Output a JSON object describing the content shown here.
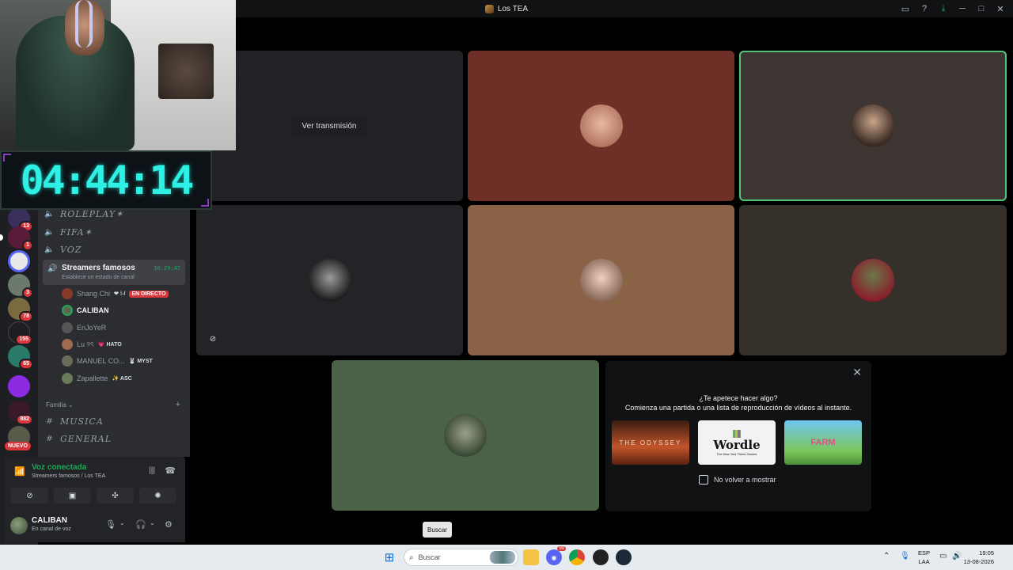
{
  "window": {
    "title": "Los TEA",
    "controls": [
      "inbox-icon",
      "help-icon",
      "download-icon",
      "minimize-icon",
      "maximize-icon",
      "close-icon"
    ]
  },
  "overlay": {
    "timer": "04:44:14"
  },
  "rail": {
    "badges": [
      "13",
      "1",
      "3",
      "78",
      "155",
      "65",
      "882"
    ],
    "new_label": "NUEVO"
  },
  "sidebar": {
    "channels_top": [
      {
        "name": "ROLEPLAY✶",
        "icon": "speaker-icon"
      },
      {
        "name": "FIFA✶",
        "icon": "speaker-icon"
      },
      {
        "name": "VOZ",
        "icon": "speaker-icon"
      }
    ],
    "voice_channel": {
      "name": "Streamers famosos",
      "status": "Establece un estado de canal",
      "timer": "30:29:47"
    },
    "members": [
      {
        "name": "Shang Chi",
        "extra": "❤ ⁞-/",
        "live": "EN DIRECTO"
      },
      {
        "name": "CALIBAN",
        "active": true
      },
      {
        "name": "EnJoYeR"
      },
      {
        "name": "Lu ୨ৎ",
        "tag": "💗 HATO"
      },
      {
        "name": "MANUEL CO...",
        "tag": "🐰 MYST"
      },
      {
        "name": "Zapallette",
        "tag": "✨ ASC"
      }
    ],
    "category": "Familia",
    "channels_bottom": [
      {
        "name": "MUSICA",
        "icon": "hash-icon"
      },
      {
        "name": "GENERAL",
        "icon": "hash-icon"
      }
    ]
  },
  "voice_panel": {
    "status": "Voz conectada",
    "location": "Streamers famosos / Los TEA"
  },
  "user_panel": {
    "name": "CALIBAN",
    "status": "En canal de voz"
  },
  "stage": {
    "watch_button": "Ver transmisión",
    "tiles": [
      {
        "color": "#202225"
      },
      {
        "color": "#6e2f26"
      },
      {
        "color": "#3d3531",
        "speaking": true
      },
      {
        "color": "#232427"
      },
      {
        "color": "#8a6346"
      },
      {
        "color": "#353029"
      },
      {
        "color": "#4c6246"
      }
    ]
  },
  "activity": {
    "question": "¿Te apetece hacer algo?",
    "description": "Comienza una partida o una lista de reproducción de vídeos al instante.",
    "games": [
      {
        "title": "THE ODYSSEY"
      },
      {
        "title": "Wordle",
        "subtitle": "The New York Times Games"
      },
      {
        "title": "FARM"
      }
    ],
    "dont_show": "No volver a mostrar"
  },
  "tooltip": "Buscar",
  "taskbar": {
    "search_placeholder": "Buscar",
    "lang_top": "ESP",
    "lang_bottom": "LAA",
    "time": "19:05",
    "date": "13-08-2026",
    "discord_badge": "99"
  }
}
